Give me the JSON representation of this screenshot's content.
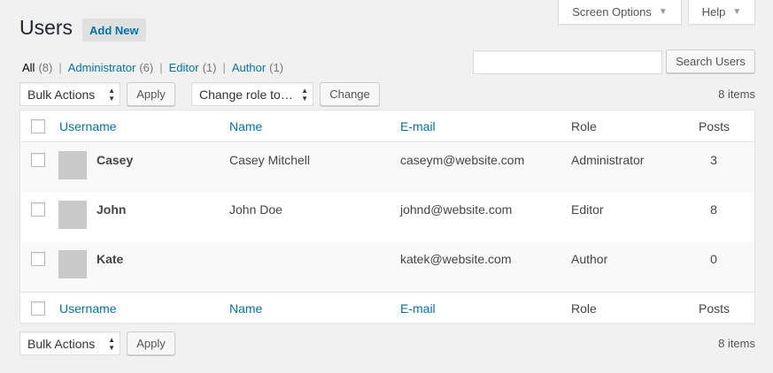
{
  "screen_options": {
    "label": "Screen Options",
    "caret": "▼"
  },
  "help": {
    "label": "Help",
    "caret": "▼"
  },
  "header": {
    "title": "Users",
    "add_new": "Add New"
  },
  "filters": [
    {
      "label": "All",
      "count": "(8)"
    },
    {
      "label": "Administrator",
      "count": "(6)"
    },
    {
      "label": "Editor",
      "count": "(1)"
    },
    {
      "label": "Author",
      "count": "(1)"
    }
  ],
  "filter_separator": "|",
  "search": {
    "value": "",
    "placeholder": "",
    "button": "Search Users"
  },
  "bulk_actions": {
    "label": "Bulk Actions",
    "apply": "Apply"
  },
  "change_role": {
    "label": "Change role to…",
    "button": "Change"
  },
  "items_count": "8 items",
  "columns": {
    "username": "Username",
    "name": "Name",
    "email": "E-mail",
    "role": "Role",
    "posts": "Posts"
  },
  "users": [
    {
      "username": "Casey",
      "name": "Casey Mitchell",
      "email": "caseym@website.com",
      "role": "Administrator",
      "posts": "3"
    },
    {
      "username": "John",
      "name": "John Doe",
      "email": "johnd@website.com",
      "role": "Editor",
      "posts": "8"
    },
    {
      "username": "Kate",
      "name": "",
      "email": "katek@website.com",
      "role": "Author",
      "posts": "0"
    }
  ],
  "colors": {
    "link": "#0073aa",
    "background": "#f1f1f1"
  }
}
